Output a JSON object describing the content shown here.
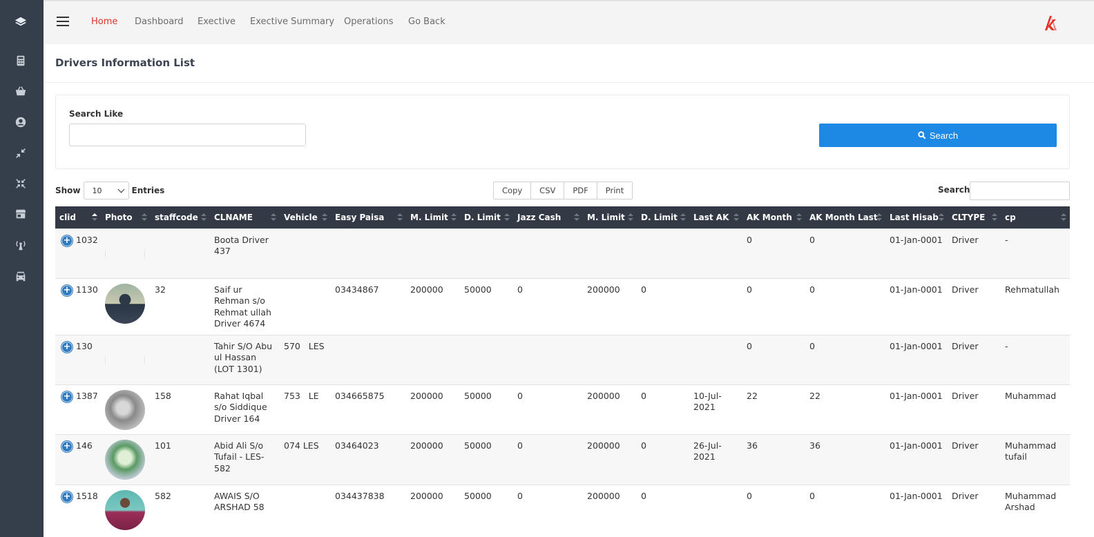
{
  "sidebar": {
    "icons": [
      "layers-icon",
      "calculator-icon",
      "basket-icon",
      "user-circle-icon",
      "compress-icon",
      "compress-arrows-icon",
      "store-icon",
      "broadcast-icon",
      "car-icon"
    ]
  },
  "nav": {
    "items": [
      "Home",
      "Dashboard",
      "Exective",
      "Exective Summary",
      "Operations",
      "Go Back"
    ],
    "active": "Home"
  },
  "colors": {
    "sidebar": "#353e4b",
    "accent": "#e5332a",
    "button": "#1e88e5",
    "header": "#343a45"
  },
  "page": {
    "title": "Drivers Information List"
  },
  "search": {
    "label": "Search Like",
    "value": "",
    "button_label": "Search"
  },
  "table_controls": {
    "show_label": "Show",
    "entries_value": "10",
    "entries_label": "Entries",
    "export_buttons": [
      "Copy",
      "CSV",
      "PDF",
      "Print"
    ],
    "search_label": "Search:"
  },
  "table": {
    "columns": [
      "clid",
      "Photo",
      "staffcode",
      "CLNAME",
      "Vehicle",
      "Easy Paisa",
      "M. Limit",
      "D. Limit",
      "Jazz Cash",
      "M. Limit",
      "D. Limit",
      "Last AK",
      "AK Month",
      "AK Month Last",
      "Last Hisab",
      "CLTYPE",
      "cp"
    ],
    "rows": [
      {
        "clid": "1032",
        "photo": "",
        "staffcode": "",
        "clname": "Boota Driver 437",
        "vehicle": "",
        "easypaisa": "",
        "mlimit": "",
        "dlimit": "",
        "jazzcash": "",
        "mlimit2": "",
        "dlimit2": "",
        "lastak": "",
        "akmonth": "0",
        "akmonthlast": "0",
        "lasthisab": "01-Jan-0001",
        "cltype": "Driver",
        "cp": "-"
      },
      {
        "clid": "1130",
        "photo": "p1",
        "staffcode": "32",
        "clname": "Saif ur Rehman s/o Rehmat ullah Driver 4674",
        "vehicle": "",
        "easypaisa": "03434867",
        "mlimit": "200000",
        "dlimit": "50000",
        "jazzcash": "0",
        "mlimit2": "200000",
        "dlimit2": "0",
        "lastak": "",
        "akmonth": "0",
        "akmonthlast": "0",
        "lasthisab": "01-Jan-0001",
        "cltype": "Driver",
        "cp": "Rehmatullah"
      },
      {
        "clid": "130",
        "photo": "",
        "staffcode": "",
        "clname": "Tahir S/O Abu ul Hassan (LOT 1301)",
        "vehicle": "570   LES",
        "easypaisa": "",
        "mlimit": "",
        "dlimit": "",
        "jazzcash": "",
        "mlimit2": "",
        "dlimit2": "",
        "lastak": "",
        "akmonth": "0",
        "akmonthlast": "0",
        "lasthisab": "01-Jan-0001",
        "cltype": "Driver",
        "cp": "-"
      },
      {
        "clid": "1387",
        "photo": "p3",
        "staffcode": "158",
        "clname": "Rahat Iqbal s/o Siddique Driver 164",
        "vehicle": "753   LE",
        "easypaisa": "034665875",
        "mlimit": "200000",
        "dlimit": "50000",
        "jazzcash": "0",
        "mlimit2": "200000",
        "dlimit2": "0",
        "lastak": "10-Jul-2021",
        "akmonth": "22",
        "akmonthlast": "22",
        "lasthisab": "01-Jan-0001",
        "cltype": "Driver",
        "cp": "Muhammad"
      },
      {
        "clid": "146",
        "photo": "p4",
        "staffcode": "101",
        "clname": "Abid Ali S/o Tufail - LES-582",
        "vehicle": "074 LES",
        "easypaisa": "03464023",
        "mlimit": "200000",
        "dlimit": "50000",
        "jazzcash": "0",
        "mlimit2": "200000",
        "dlimit2": "0",
        "lastak": "26-Jul-2021",
        "akmonth": "36",
        "akmonthlast": "36",
        "lasthisab": "01-Jan-0001",
        "cltype": "Driver",
        "cp": "Muhammad tufail"
      },
      {
        "clid": "1518",
        "photo": "p5",
        "staffcode": "582",
        "clname": "AWAIS S/O ARSHAD 58",
        "vehicle": "",
        "easypaisa": "034437838",
        "mlimit": "200000",
        "dlimit": "50000",
        "jazzcash": "0",
        "mlimit2": "200000",
        "dlimit2": "0",
        "lastak": "",
        "akmonth": "0",
        "akmonthlast": "0",
        "lasthisab": "01-Jan-0001",
        "cltype": "Driver",
        "cp": "Muhammad Arshad"
      }
    ]
  }
}
